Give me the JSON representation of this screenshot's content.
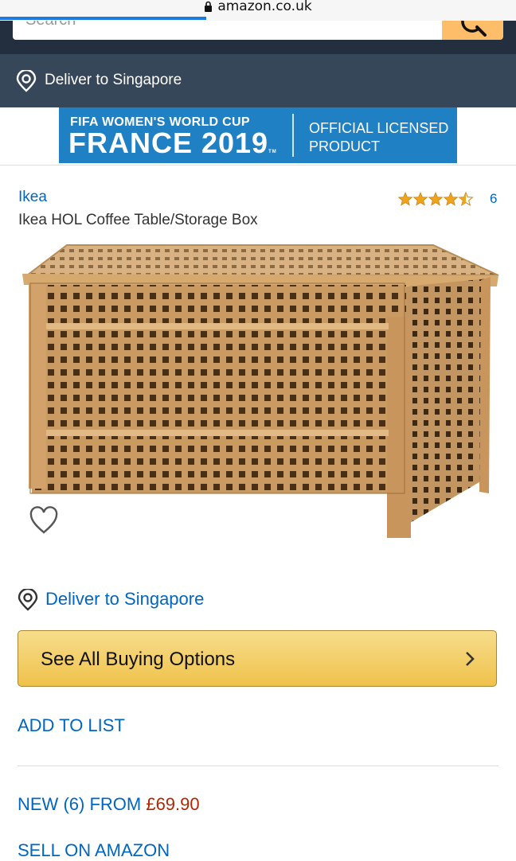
{
  "browser": {
    "url": "amazon.co.uk",
    "load_progress": 0.4
  },
  "header": {
    "search_placeholder": "Search"
  },
  "deliver_bar": {
    "label": "Deliver to Singapore"
  },
  "banner": {
    "line1": "FIFA WOMEN'S WORLD CUP",
    "line2": "FRANCE 2019",
    "tm": "TM",
    "right_line1": "OFFICIAL LICENSED",
    "right_line2": "PRODUCT"
  },
  "product": {
    "brand": "Ikea",
    "title": "Ikea HOL Coffee Table/Storage Box",
    "rating": 4.5,
    "review_count": "6"
  },
  "deliver": {
    "label": "Deliver to Singapore"
  },
  "buy_button": {
    "label": "See All Buying Options"
  },
  "add_to_list": {
    "label": "ADD TO LIST"
  },
  "offers": {
    "label": "NEW (6) FROM",
    "price": "£69.90"
  },
  "sell": {
    "label": "SELL ON AMAZON"
  },
  "colors": {
    "header_bg": "#232f3e",
    "deliver_bar_bg": "#37475a",
    "link": "#0066c0",
    "price": "#b12704",
    "star": "#f0a31c",
    "button": "#f0c14b",
    "banner_bg": "#1f80c4"
  }
}
